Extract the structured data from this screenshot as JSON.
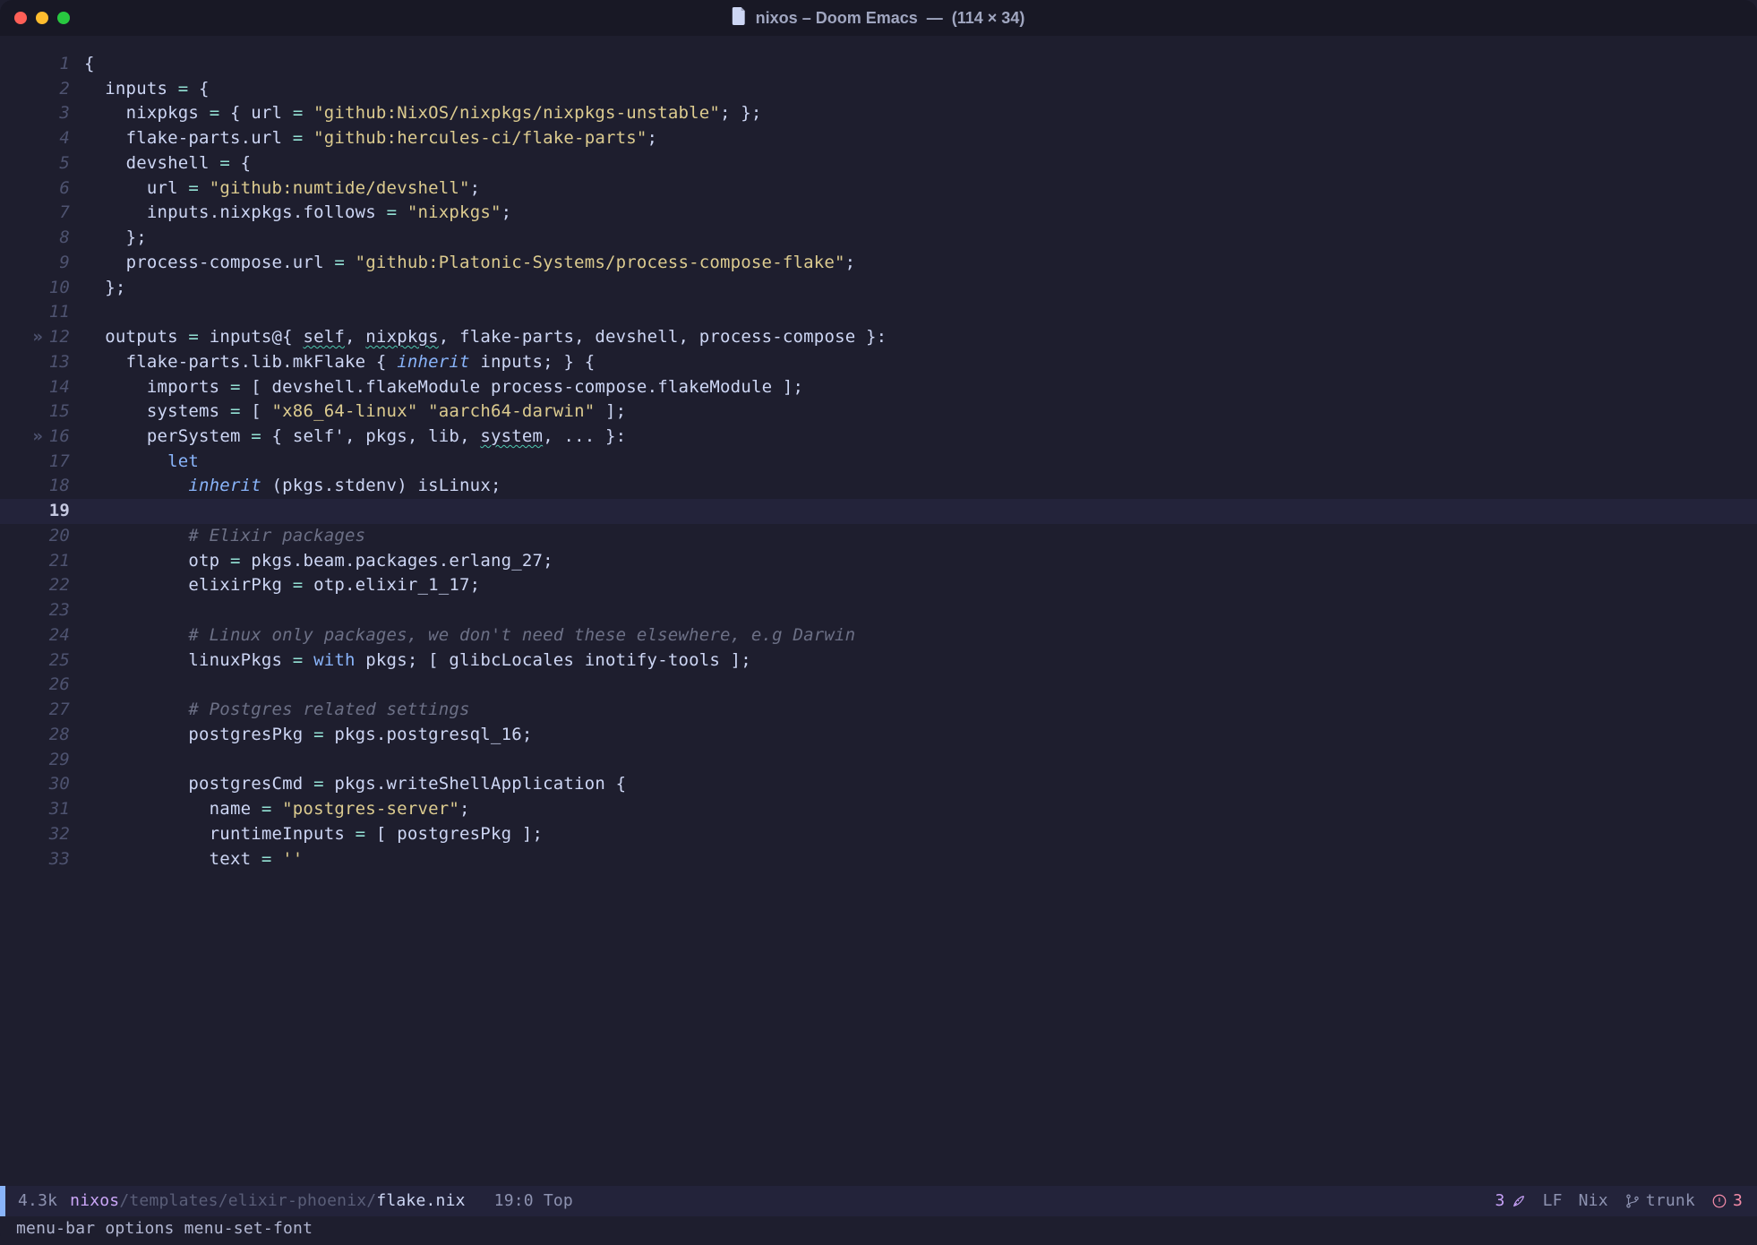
{
  "window": {
    "title_main": "nixos – Doom Emacs",
    "title_sep": "—",
    "title_dims": "(114 × 34)"
  },
  "modeline": {
    "file_size": "4.3k",
    "path_root": "nixos",
    "path_mid": "/templates/elixir-phoenix/",
    "path_file": "flake.nix",
    "cursor_pos": "19:0",
    "scroll_pos": "Top",
    "lsp_count": "3",
    "encoding": "LF",
    "mode": "Nix",
    "branch": "trunk",
    "error_count": "3"
  },
  "echo": "menu-bar options menu-set-font",
  "lines": [
    {
      "n": "1",
      "fold": "",
      "tokens": [
        [
          "punc",
          "{"
        ]
      ]
    },
    {
      "n": "2",
      "fold": "",
      "tokens": [
        [
          "plain",
          "  "
        ],
        [
          "ident",
          "inputs"
        ],
        [
          "plain",
          " "
        ],
        [
          "assign",
          "="
        ],
        [
          "plain",
          " "
        ],
        [
          "punc",
          "{"
        ]
      ]
    },
    {
      "n": "3",
      "fold": "",
      "tokens": [
        [
          "plain",
          "    "
        ],
        [
          "ident",
          "nixpkgs"
        ],
        [
          "plain",
          " "
        ],
        [
          "assign",
          "="
        ],
        [
          "plain",
          " "
        ],
        [
          "punc",
          "{"
        ],
        [
          "plain",
          " "
        ],
        [
          "ident",
          "url"
        ],
        [
          "plain",
          " "
        ],
        [
          "assign",
          "="
        ],
        [
          "plain",
          " "
        ],
        [
          "string",
          "\"github:NixOS/nixpkgs/nixpkgs-unstable\""
        ],
        [
          "punc",
          "; };"
        ]
      ]
    },
    {
      "n": "4",
      "fold": "",
      "tokens": [
        [
          "plain",
          "    "
        ],
        [
          "ident",
          "flake-parts"
        ],
        [
          "punc",
          "."
        ],
        [
          "ident",
          "url"
        ],
        [
          "plain",
          " "
        ],
        [
          "assign",
          "="
        ],
        [
          "plain",
          " "
        ],
        [
          "string",
          "\"github:hercules-ci/flake-parts\""
        ],
        [
          "punc",
          ";"
        ]
      ]
    },
    {
      "n": "5",
      "fold": "",
      "tokens": [
        [
          "plain",
          "    "
        ],
        [
          "ident",
          "devshell"
        ],
        [
          "plain",
          " "
        ],
        [
          "assign",
          "="
        ],
        [
          "plain",
          " "
        ],
        [
          "punc",
          "{"
        ]
      ]
    },
    {
      "n": "6",
      "fold": "",
      "tokens": [
        [
          "plain",
          "      "
        ],
        [
          "ident",
          "url"
        ],
        [
          "plain",
          " "
        ],
        [
          "assign",
          "="
        ],
        [
          "plain",
          " "
        ],
        [
          "string",
          "\"github:numtide/devshell\""
        ],
        [
          "punc",
          ";"
        ]
      ]
    },
    {
      "n": "7",
      "fold": "",
      "tokens": [
        [
          "plain",
          "      "
        ],
        [
          "ident",
          "inputs"
        ],
        [
          "punc",
          "."
        ],
        [
          "ident",
          "nixpkgs"
        ],
        [
          "punc",
          "."
        ],
        [
          "ident",
          "follows"
        ],
        [
          "plain",
          " "
        ],
        [
          "assign",
          "="
        ],
        [
          "plain",
          " "
        ],
        [
          "string",
          "\"nixpkgs\""
        ],
        [
          "punc",
          ";"
        ]
      ]
    },
    {
      "n": "8",
      "fold": "",
      "tokens": [
        [
          "plain",
          "    "
        ],
        [
          "punc",
          "};"
        ]
      ]
    },
    {
      "n": "9",
      "fold": "",
      "tokens": [
        [
          "plain",
          "    "
        ],
        [
          "ident",
          "process-compose"
        ],
        [
          "punc",
          "."
        ],
        [
          "ident",
          "url"
        ],
        [
          "plain",
          " "
        ],
        [
          "assign",
          "="
        ],
        [
          "plain",
          " "
        ],
        [
          "string",
          "\"github:Platonic-Systems/process-compose-flake\""
        ],
        [
          "punc",
          ";"
        ]
      ]
    },
    {
      "n": "10",
      "fold": "",
      "tokens": [
        [
          "plain",
          "  "
        ],
        [
          "punc",
          "};"
        ]
      ]
    },
    {
      "n": "11",
      "fold": "",
      "tokens": [
        [
          "plain",
          ""
        ]
      ]
    },
    {
      "n": "12",
      "fold": "»",
      "tokens": [
        [
          "plain",
          "  "
        ],
        [
          "ident",
          "outputs"
        ],
        [
          "plain",
          " "
        ],
        [
          "assign",
          "="
        ],
        [
          "plain",
          " "
        ],
        [
          "ident",
          "inputs"
        ],
        [
          "punc",
          "@{"
        ],
        [
          "plain",
          " "
        ],
        [
          "warn",
          "self"
        ],
        [
          "punc",
          ","
        ],
        [
          "plain",
          " "
        ],
        [
          "warn",
          "nixpkgs"
        ],
        [
          "punc",
          ","
        ],
        [
          "plain",
          " "
        ],
        [
          "ident",
          "flake-parts"
        ],
        [
          "punc",
          ","
        ],
        [
          "plain",
          " "
        ],
        [
          "ident",
          "devshell"
        ],
        [
          "punc",
          ","
        ],
        [
          "plain",
          " "
        ],
        [
          "ident",
          "process-compose"
        ],
        [
          "plain",
          " "
        ],
        [
          "punc",
          "}:"
        ]
      ]
    },
    {
      "n": "13",
      "fold": "",
      "tokens": [
        [
          "plain",
          "    "
        ],
        [
          "ident",
          "flake-parts"
        ],
        [
          "punc",
          "."
        ],
        [
          "ident",
          "lib"
        ],
        [
          "punc",
          "."
        ],
        [
          "ident",
          "mkFlake"
        ],
        [
          "plain",
          " "
        ],
        [
          "punc",
          "{"
        ],
        [
          "plain",
          " "
        ],
        [
          "inherit",
          "inherit"
        ],
        [
          "plain",
          " "
        ],
        [
          "ident",
          "inputs"
        ],
        [
          "punc",
          ";"
        ],
        [
          "plain",
          " "
        ],
        [
          "punc",
          "} {"
        ]
      ]
    },
    {
      "n": "14",
      "fold": "",
      "tokens": [
        [
          "plain",
          "      "
        ],
        [
          "ident",
          "imports"
        ],
        [
          "plain",
          " "
        ],
        [
          "assign",
          "="
        ],
        [
          "plain",
          " "
        ],
        [
          "punc",
          "["
        ],
        [
          "plain",
          " "
        ],
        [
          "ident",
          "devshell"
        ],
        [
          "punc",
          "."
        ],
        [
          "ident",
          "flakeModule"
        ],
        [
          "plain",
          " "
        ],
        [
          "ident",
          "process-compose"
        ],
        [
          "punc",
          "."
        ],
        [
          "ident",
          "flakeModule"
        ],
        [
          "plain",
          " "
        ],
        [
          "punc",
          "];"
        ]
      ]
    },
    {
      "n": "15",
      "fold": "",
      "tokens": [
        [
          "plain",
          "      "
        ],
        [
          "ident",
          "systems"
        ],
        [
          "plain",
          " "
        ],
        [
          "assign",
          "="
        ],
        [
          "plain",
          " "
        ],
        [
          "punc",
          "["
        ],
        [
          "plain",
          " "
        ],
        [
          "string",
          "\"x86_64-linux\""
        ],
        [
          "plain",
          " "
        ],
        [
          "string",
          "\"aarch64-darwin\""
        ],
        [
          "plain",
          " "
        ],
        [
          "punc",
          "];"
        ]
      ]
    },
    {
      "n": "16",
      "fold": "»",
      "tokens": [
        [
          "plain",
          "      "
        ],
        [
          "ident",
          "perSystem"
        ],
        [
          "plain",
          " "
        ],
        [
          "assign",
          "="
        ],
        [
          "plain",
          " "
        ],
        [
          "punc",
          "{"
        ],
        [
          "plain",
          " "
        ],
        [
          "ident",
          "self'"
        ],
        [
          "punc",
          ","
        ],
        [
          "plain",
          " "
        ],
        [
          "ident",
          "pkgs"
        ],
        [
          "punc",
          ","
        ],
        [
          "plain",
          " "
        ],
        [
          "ident",
          "lib"
        ],
        [
          "punc",
          ","
        ],
        [
          "plain",
          " "
        ],
        [
          "warn",
          "system"
        ],
        [
          "punc",
          ","
        ],
        [
          "plain",
          " "
        ],
        [
          "punc",
          "... }:"
        ]
      ]
    },
    {
      "n": "17",
      "fold": "",
      "tokens": [
        [
          "plain",
          "        "
        ],
        [
          "key",
          "let"
        ]
      ]
    },
    {
      "n": "18",
      "fold": "",
      "tokens": [
        [
          "plain",
          "          "
        ],
        [
          "inherit",
          "inherit"
        ],
        [
          "plain",
          " "
        ],
        [
          "punc",
          "("
        ],
        [
          "ident",
          "pkgs"
        ],
        [
          "punc",
          "."
        ],
        [
          "ident",
          "stdenv"
        ],
        [
          "punc",
          ")"
        ],
        [
          "plain",
          " "
        ],
        [
          "ident",
          "isLinux"
        ],
        [
          "punc",
          ";"
        ]
      ]
    },
    {
      "n": "19",
      "fold": "",
      "current": true,
      "tokens": [
        [
          "plain",
          ""
        ]
      ]
    },
    {
      "n": "20",
      "fold": "",
      "tokens": [
        [
          "plain",
          "          "
        ],
        [
          "comment",
          "# Elixir packages"
        ]
      ]
    },
    {
      "n": "21",
      "fold": "",
      "tokens": [
        [
          "plain",
          "          "
        ],
        [
          "ident",
          "otp"
        ],
        [
          "plain",
          " "
        ],
        [
          "assign",
          "="
        ],
        [
          "plain",
          " "
        ],
        [
          "ident",
          "pkgs"
        ],
        [
          "punc",
          "."
        ],
        [
          "ident",
          "beam"
        ],
        [
          "punc",
          "."
        ],
        [
          "ident",
          "packages"
        ],
        [
          "punc",
          "."
        ],
        [
          "ident",
          "erlang_27"
        ],
        [
          "punc",
          ";"
        ]
      ]
    },
    {
      "n": "22",
      "fold": "",
      "tokens": [
        [
          "plain",
          "          "
        ],
        [
          "ident",
          "elixirPkg"
        ],
        [
          "plain",
          " "
        ],
        [
          "assign",
          "="
        ],
        [
          "plain",
          " "
        ],
        [
          "ident",
          "otp"
        ],
        [
          "punc",
          "."
        ],
        [
          "ident",
          "elixir_1_17"
        ],
        [
          "punc",
          ";"
        ]
      ]
    },
    {
      "n": "23",
      "fold": "",
      "tokens": [
        [
          "plain",
          ""
        ]
      ]
    },
    {
      "n": "24",
      "fold": "",
      "tokens": [
        [
          "plain",
          "          "
        ],
        [
          "comment",
          "# Linux only packages, we don't need these elsewhere, e.g Darwin"
        ]
      ]
    },
    {
      "n": "25",
      "fold": "",
      "tokens": [
        [
          "plain",
          "          "
        ],
        [
          "ident",
          "linuxPkgs"
        ],
        [
          "plain",
          " "
        ],
        [
          "assign",
          "="
        ],
        [
          "plain",
          " "
        ],
        [
          "key",
          "with"
        ],
        [
          "plain",
          " "
        ],
        [
          "ident",
          "pkgs"
        ],
        [
          "punc",
          ";"
        ],
        [
          "plain",
          " "
        ],
        [
          "punc",
          "["
        ],
        [
          "plain",
          " "
        ],
        [
          "ident",
          "glibcLocales"
        ],
        [
          "plain",
          " "
        ],
        [
          "ident",
          "inotify-tools"
        ],
        [
          "plain",
          " "
        ],
        [
          "punc",
          "];"
        ]
      ]
    },
    {
      "n": "26",
      "fold": "",
      "tokens": [
        [
          "plain",
          ""
        ]
      ]
    },
    {
      "n": "27",
      "fold": "",
      "tokens": [
        [
          "plain",
          "          "
        ],
        [
          "comment",
          "# Postgres related settings"
        ]
      ]
    },
    {
      "n": "28",
      "fold": "",
      "tokens": [
        [
          "plain",
          "          "
        ],
        [
          "ident",
          "postgresPkg"
        ],
        [
          "plain",
          " "
        ],
        [
          "assign",
          "="
        ],
        [
          "plain",
          " "
        ],
        [
          "ident",
          "pkgs"
        ],
        [
          "punc",
          "."
        ],
        [
          "ident",
          "postgresql_16"
        ],
        [
          "punc",
          ";"
        ]
      ]
    },
    {
      "n": "29",
      "fold": "",
      "tokens": [
        [
          "plain",
          ""
        ]
      ]
    },
    {
      "n": "30",
      "fold": "",
      "tokens": [
        [
          "plain",
          "          "
        ],
        [
          "ident",
          "postgresCmd"
        ],
        [
          "plain",
          " "
        ],
        [
          "assign",
          "="
        ],
        [
          "plain",
          " "
        ],
        [
          "ident",
          "pkgs"
        ],
        [
          "punc",
          "."
        ],
        [
          "ident",
          "writeShellApplication"
        ],
        [
          "plain",
          " "
        ],
        [
          "punc",
          "{"
        ]
      ]
    },
    {
      "n": "31",
      "fold": "",
      "tokens": [
        [
          "plain",
          "            "
        ],
        [
          "ident",
          "name"
        ],
        [
          "plain",
          " "
        ],
        [
          "assign",
          "="
        ],
        [
          "plain",
          " "
        ],
        [
          "string",
          "\"postgres-server\""
        ],
        [
          "punc",
          ";"
        ]
      ]
    },
    {
      "n": "32",
      "fold": "",
      "tokens": [
        [
          "plain",
          "            "
        ],
        [
          "ident",
          "runtimeInputs"
        ],
        [
          "plain",
          " "
        ],
        [
          "assign",
          "="
        ],
        [
          "plain",
          " "
        ],
        [
          "punc",
          "["
        ],
        [
          "plain",
          " "
        ],
        [
          "ident",
          "postgresPkg"
        ],
        [
          "plain",
          " "
        ],
        [
          "punc",
          "];"
        ]
      ]
    },
    {
      "n": "33",
      "fold": "",
      "tokens": [
        [
          "plain",
          "            "
        ],
        [
          "ident",
          "text"
        ],
        [
          "plain",
          " "
        ],
        [
          "assign",
          "="
        ],
        [
          "plain",
          " "
        ],
        [
          "string",
          "''"
        ]
      ]
    }
  ]
}
